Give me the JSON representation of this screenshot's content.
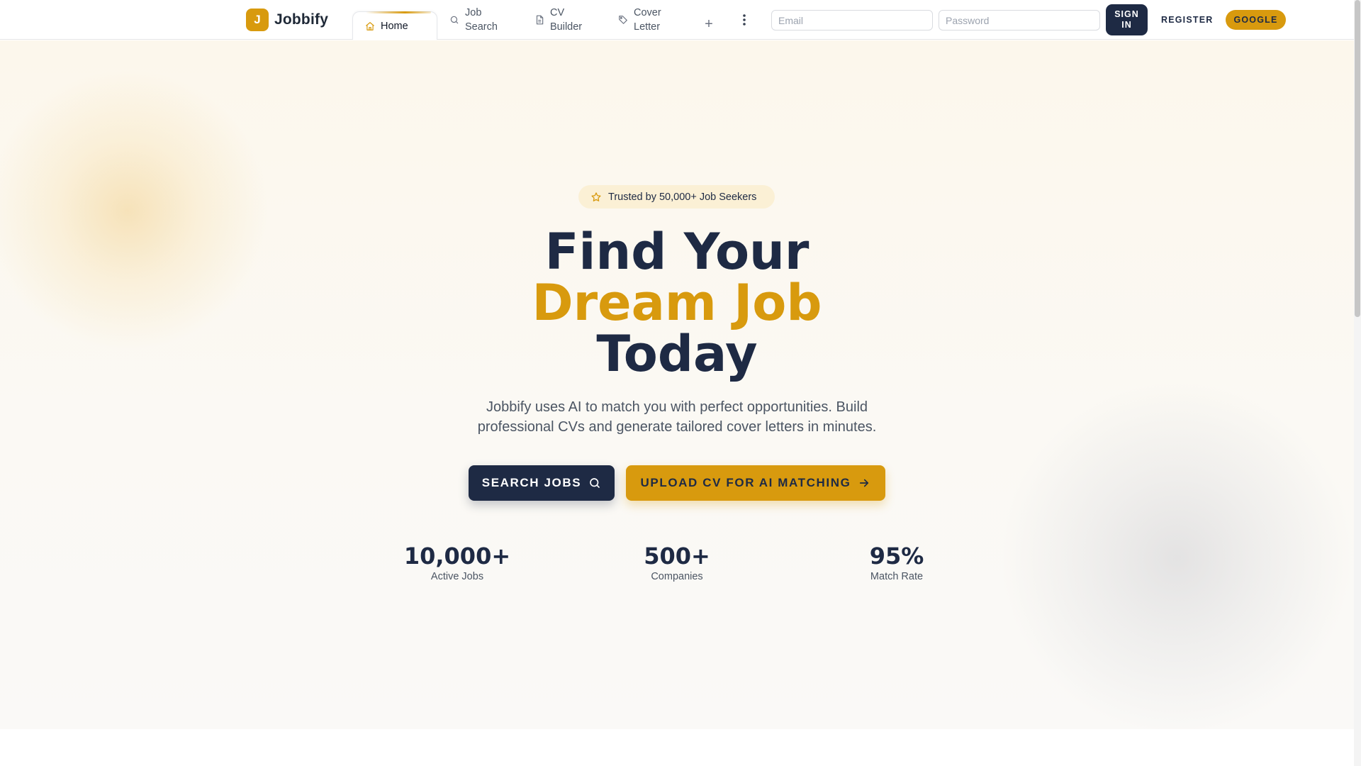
{
  "app": {
    "name": "Jobbify",
    "logo_letter": "J"
  },
  "nav": {
    "tabs": [
      {
        "label": "Home",
        "icon": "home-icon",
        "active": true
      },
      {
        "label": "Job Search",
        "icon": "search-icon",
        "active": false
      },
      {
        "label": "CV Builder",
        "icon": "document-icon",
        "active": false
      },
      {
        "label": "Cover Letter",
        "icon": "tag-icon",
        "active": false
      }
    ],
    "add_tab_icon": "plus-icon",
    "more_icon": "more-vertical-icon"
  },
  "auth": {
    "email_placeholder": "Email",
    "email_value": "",
    "password_placeholder": "Password",
    "password_value": "",
    "signin_label": "SIGN IN",
    "register_label": "REGISTER",
    "google_label": "GOOGLE"
  },
  "hero": {
    "badge_icon": "star-icon",
    "badge_text": "Trusted by 50,000+ Job Seekers",
    "title_line1": "Find Your",
    "title_line2": "Dream Job",
    "title_line3": "Today",
    "subtitle": "Jobbify uses AI to match you with perfect opportunities. Build professional CVs and generate tailored cover letters in minutes.",
    "primary_cta": "SEARCH JOBS",
    "primary_cta_icon": "search-icon",
    "secondary_cta": "UPLOAD CV FOR AI MATCHING",
    "secondary_cta_icon": "arrow-right-icon"
  },
  "stats": [
    {
      "value": "10,000+",
      "label": "Active Jobs"
    },
    {
      "value": "500+",
      "label": "Companies"
    },
    {
      "value": "95%",
      "label": "Match Rate"
    }
  ],
  "colors": {
    "brand_gold": "#d89a0e",
    "navy": "#1e2a44",
    "badge_bg": "#fbf0d5",
    "hero_bg": "#fcf7ec"
  }
}
